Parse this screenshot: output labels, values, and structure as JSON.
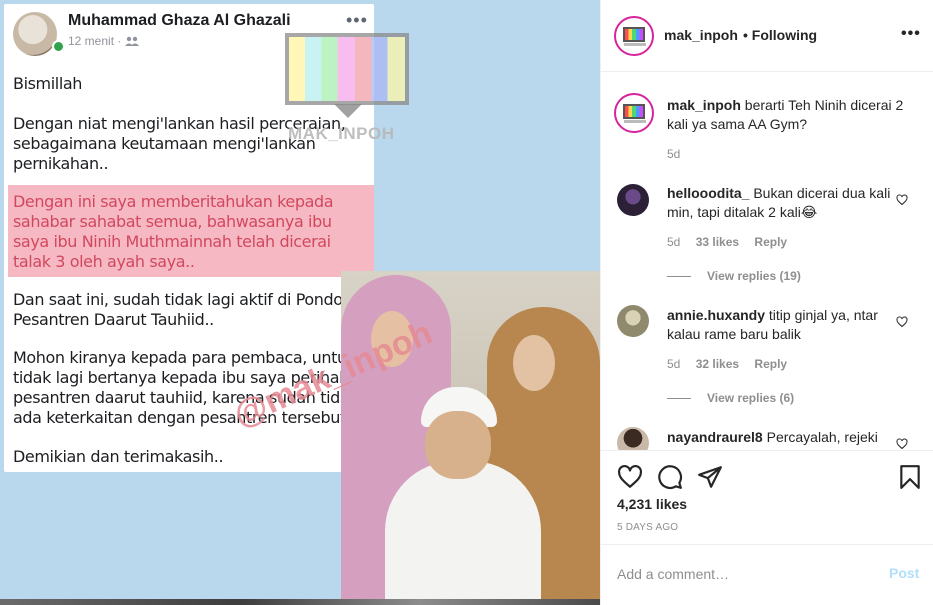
{
  "fb_post": {
    "author": "Muhammad Ghaza Al Ghazali",
    "time": "12 menit",
    "privacy_icon": "friends-icon",
    "more": "•••",
    "paragraphs": [
      "Bismillah",
      "Dengan niat mengi'lankan hasil perceraian, sebagaimana keutamaan mengi'lankan pernikahan..",
      "Dengan ini saya memberitahukan kepada sahabar sahabat semua, bahwasanya ibu saya ibu Ninih Muthmainnah telah dicerai talak 3 oleh ayah saya..",
      "Dan saat ini, sudah tidak lagi aktif di Pondok Pesantren Daarut Tauhiid..",
      "Mohon kiranya kepada para pembaca, untuk tidak lagi bertanya kepada ibu saya perihal pesantren daarut tauhiid, karena sudah tidak ada keterkaitan dengan pesantren tersebut..",
      "Demikian dan terimakasih.."
    ],
    "highlight_color": "#f6b9c4"
  },
  "watermarks": {
    "logo_text": "MAK_INPOH",
    "handle": "@mak_inpoh"
  },
  "header": {
    "username": "mak_inpoh",
    "following": "• Following",
    "more": "•••"
  },
  "comments": [
    {
      "user": "mak_inpoh",
      "text": "berarti Teh Ninih dicerai 2 kali ya sama AA Gym?",
      "age": "5d"
    },
    {
      "user": "hellooodita_",
      "text": "Bukan dicerai dua kali min, tapi ditalak 2 kali😂",
      "age": "5d",
      "likes": "33 likes",
      "reply": "Reply",
      "view_replies": "View replies (19)"
    },
    {
      "user": "annie.huxandy",
      "text": "titip ginjal ya, ntar kalau rame baru balik",
      "age": "5d",
      "likes": "32 likes",
      "reply": "Reply",
      "view_replies": "View replies (6)"
    },
    {
      "user": "nayandraurel8",
      "text": "Percayalah, rejeki"
    }
  ],
  "actions": {
    "like_icon": "heart-icon",
    "comment_icon": "comment-icon",
    "share_icon": "share-icon",
    "save_icon": "bookmark-icon",
    "likes": "4,231 likes",
    "date": "5 DAYS AGO"
  },
  "comment_form": {
    "placeholder": "Add a comment…",
    "post_label": "Post"
  },
  "colors": {
    "accent_disabled": "#b2dffc",
    "muted": "#8e8e8e",
    "text": "#262626",
    "image_bg": "#b9d8ee"
  }
}
